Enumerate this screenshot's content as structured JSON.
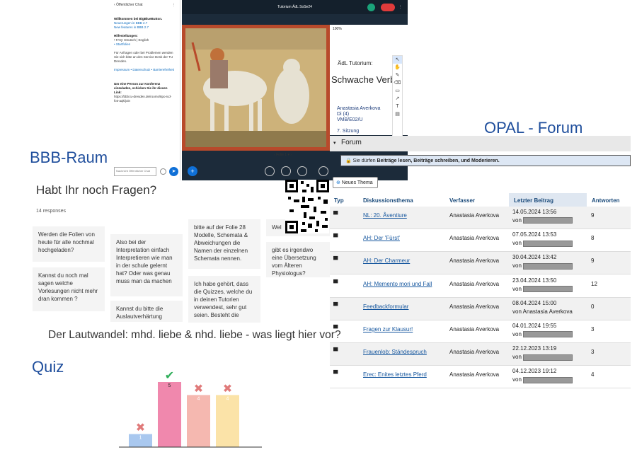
{
  "labels": {
    "bbb": "BBB-Raum",
    "opal": "OPAL - Forum",
    "quiz": "Quiz"
  },
  "bbb": {
    "chat_header": "Öffentlicher Chat",
    "welcome": "Willkommen bei BigBlueButton.",
    "new_line1": "Neuerungen in BBB 2.7",
    "new_line2": "New features in BBB 2.7",
    "help_title": "Hilfestellungen:",
    "faq": "• FAQ: Deutsch | English",
    "start": "• Startfolien",
    "problems": "Für Anfragen oder bei Problemen wenden Sie sich bitte an den Service Desk der TU Dresden.",
    "links": "Impressum • Datenschutz • Barrierefreiheit",
    "invite": "Um eine Person zur Konferenz einzuladen, schicken Sie ihr diesen Link:",
    "invite_link": "https://bbb.tu-dresden.de/rooms/8po-icd-fc6-aqk/join",
    "chat_placeholder": "Nachricht Öffentlicher Chat",
    "title": "Tutorium ÄdL SoSe24",
    "slide_tutorium": "ÄdL Tutorium:",
    "slide_heading": "Schwache Verbe",
    "slide_name": "Anastasia Averkova",
    "slide_day": "Di (4)",
    "slide_room": "VMB/E02/U",
    "slide_session": "7. Sitzung",
    "slide_label": "Folie 1",
    "zoom": "100%"
  },
  "survey": {
    "title": "Habt Ihr noch Fragen?",
    "responses": "14 responses",
    "cards": [
      "Werden die Folien von heute für alle nochmal hochgeladen?",
      "Kannst du noch mal sagen welche Vorlesungen nicht mehr dran kommen ?",
      "Also bei der Interpretation einfach Interpretieren wie man in der schule gelernt hat? Oder was genau muss man da machen",
      "Kannst du bitte die Auslautverhärtung",
      "bitte auf der Folie 28 Modelle, Schemata & Abweichungen die Namen der einzelnen Schemata nennen.",
      "Ich habe gehört, dass die Quizzes, welche du in deinen Tutorien verwendest, sehr gut seien. Besteht die",
      "Wel",
      "gibt es irgendwo eine Übersetzung vom Älteren Physiologus?"
    ]
  },
  "lautwandel": "Der Lautwandel: mhd. liebe & nhd. liebe - was liegt hier vor?",
  "opal": {
    "forum_title": "Forum",
    "permission_prefix": "Sie dürfen",
    "permission_text": "Beiträge lesen, Beiträge schreiben, und Moderieren.",
    "new_topic": "Neues Thema",
    "columns": [
      "Typ",
      "Diskussionsthema",
      "Verfasser",
      "Letzter Beitrag",
      "Antworten"
    ],
    "rows": [
      {
        "topic": "NL: 20. Âventiure",
        "author": "Anastasia Averkova",
        "date": "14.05.2024 13:56",
        "by": "von",
        "replies": "9"
      },
      {
        "topic": "AH: Der 'Fürst'",
        "author": "Anastasia Averkova",
        "date": "07.05.2024 13:53",
        "by": "von",
        "replies": "8"
      },
      {
        "topic": "AH: Der Charmeur",
        "author": "Anastasia Averkova",
        "date": "30.04.2024 13:42",
        "by": "von",
        "replies": "9"
      },
      {
        "topic": "AH: Memento mori und Fall",
        "author": "Anastasia Averkova",
        "date": "23.04.2024 13:50",
        "by": "von",
        "replies": "12"
      },
      {
        "topic": "Feedbackformular",
        "author": "Anastasia Averkova",
        "date": "08.04.2024 15:00",
        "by": "von Anastasia Averkova",
        "replies": "0"
      },
      {
        "topic": "Fragen zur Klausur!",
        "author": "Anastasia Averkova",
        "date": "04.01.2024 19:55",
        "by": "von",
        "replies": "3"
      },
      {
        "topic": "Frauenlob: Ständespruch",
        "author": "Anastasia Averkova",
        "date": "22.12.2023 13:19",
        "by": "von",
        "replies": "3"
      },
      {
        "topic": "Erec: Enites letztes Pferd",
        "author": "Anastasia Averkova",
        "date": "04.12.2023 19:12",
        "by": "von",
        "replies": "4"
      }
    ]
  },
  "chart_data": {
    "type": "bar",
    "categories": [
      "",
      "",
      "",
      ""
    ],
    "values": [
      1,
      5,
      4,
      4
    ],
    "correct": [
      false,
      true,
      false,
      false
    ],
    "colors": [
      "#a9c8ef",
      "#f088ad",
      "#f5b8b0",
      "#fbe3a8"
    ],
    "ylim": [
      0,
      6
    ]
  }
}
